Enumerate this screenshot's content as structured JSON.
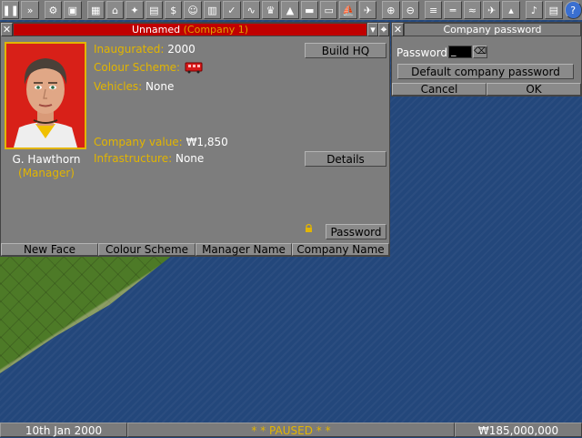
{
  "toolbar": {
    "icons": [
      "pause-icon",
      "fast-forward-icon",
      "settings-icon",
      "save-icon",
      "minimap-icon",
      "town-directory-icon",
      "subsidies-icon",
      "station-list-icon",
      "finances-icon",
      "company-icon",
      "story-book-icon",
      "goal-list-icon",
      "graphs-icon",
      "league-table-icon",
      "industries-icon",
      "train-list-icon",
      "road-vehicle-list-icon",
      "ship-list-icon",
      "aircraft-list-icon",
      "zoom-in-icon",
      "zoom-out-icon",
      "rail-construction-icon",
      "road-construction-icon",
      "water-construction-icon",
      "air-construction-icon",
      "landscaping-icon",
      "music-icon",
      "newspaper-icon",
      "help-icon"
    ]
  },
  "company_window": {
    "title_name": "Unnamed",
    "title_company": "(Company 1)",
    "manager_name": "G. Hawthorn",
    "manager_role": "(Manager)",
    "inaugurated_label": "Inaugurated:",
    "inaugurated_value": "2000",
    "colour_label": "Colour Scheme:",
    "vehicles_label": "Vehicles:",
    "vehicles_value": "None",
    "value_label": "Company value:",
    "value_value": "₩1,850",
    "infra_label": "Infrastructure:",
    "infra_value": "None",
    "build_hq": "Build HQ",
    "details": "Details",
    "password": "Password",
    "new_face": "New Face",
    "colour_scheme": "Colour Scheme",
    "manager_name_btn": "Manager Name",
    "company_name_btn": "Company Name",
    "colors": {
      "title_bar": "#c00000",
      "accent": "#e2b500"
    }
  },
  "password_window": {
    "title": "Company password",
    "password_label": "Password",
    "input_value": "_",
    "clear_label": "⌫",
    "default_btn": "Default company password",
    "cancel": "Cancel",
    "ok": "OK"
  },
  "statusbar": {
    "date": "10th Jan 2000",
    "status": "* * PAUSED * *",
    "money": "₩185,000,000"
  }
}
